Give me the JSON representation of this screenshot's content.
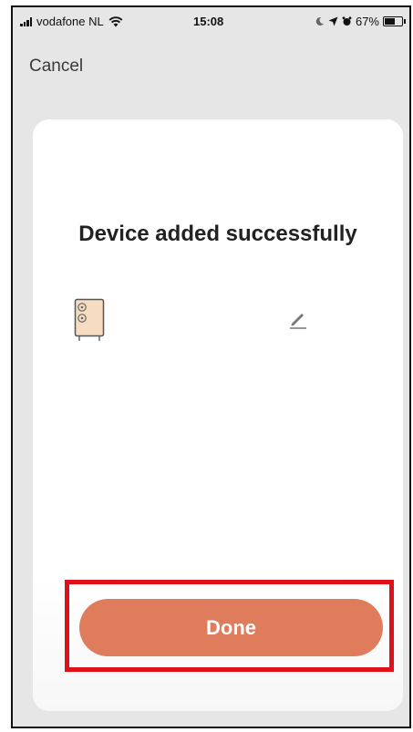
{
  "status_bar": {
    "carrier": "vodafone NL",
    "time": "15:08",
    "battery_percent": "67%",
    "battery_level": 0.67,
    "icons": [
      "signal-icon",
      "wifi-icon",
      "moon-icon",
      "location-icon",
      "alarm-icon",
      "battery-icon"
    ]
  },
  "nav": {
    "cancel_label": "Cancel"
  },
  "card": {
    "title": "Device added successfully",
    "device_icon": "smart-socket-icon",
    "device_icon_color": "#f6dcc0",
    "edit_icon": "pencil-icon"
  },
  "actions": {
    "done_label": "Done",
    "done_color": "#de7c5c",
    "highlight_color": "#e0101a"
  },
  "colors": {
    "background": "#e6e6e6",
    "card": "#ffffff",
    "text": "#222222"
  }
}
